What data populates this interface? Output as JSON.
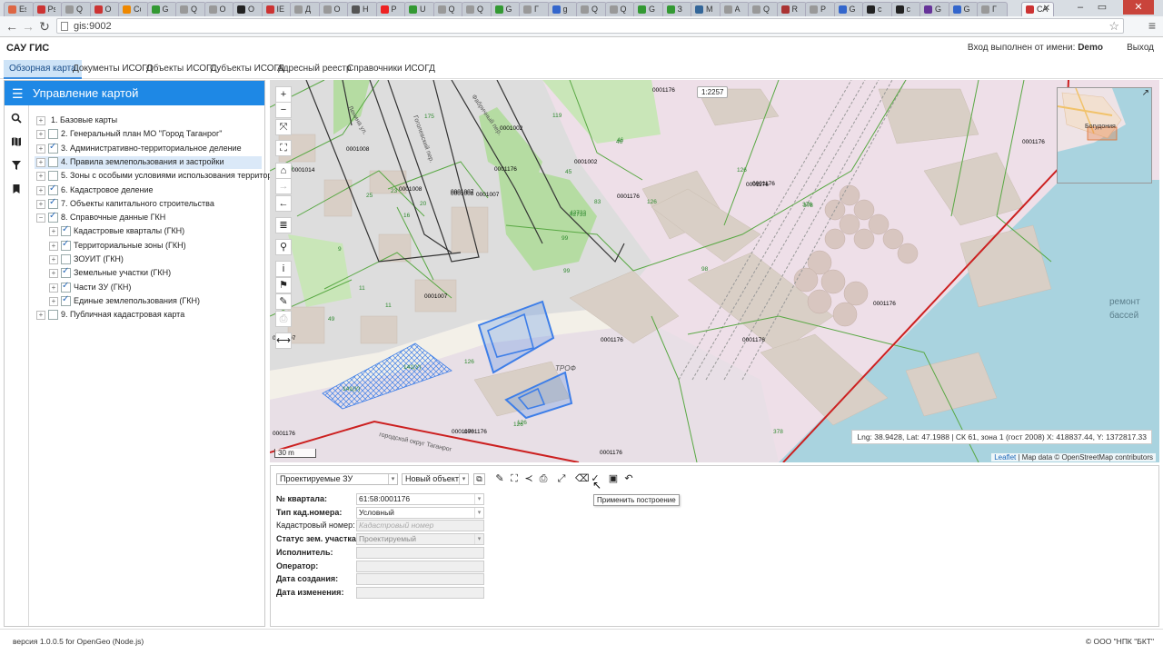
{
  "browser": {
    "url": "gis:9002",
    "active_tab_label": "СА",
    "tabs": [
      {
        "fav": "#d64",
        "label": "Es"
      },
      {
        "fav": "#c33",
        "label": "Ps"
      },
      {
        "fav": "#999",
        "label": "Q"
      },
      {
        "fav": "#c33",
        "label": "O"
      },
      {
        "fav": "#e80",
        "label": "Co"
      },
      {
        "fav": "#393",
        "label": "G"
      },
      {
        "fav": "#999",
        "label": "Q"
      },
      {
        "fav": "#999",
        "label": "O"
      },
      {
        "fav": "#222",
        "label": "O"
      },
      {
        "fav": "#c33",
        "label": "IE"
      },
      {
        "fav": "#999",
        "label": "Д"
      },
      {
        "fav": "#999",
        "label": "O"
      },
      {
        "fav": "#555",
        "label": "H"
      },
      {
        "fav": "#e22",
        "label": "P"
      },
      {
        "fav": "#393",
        "label": "U"
      },
      {
        "fav": "#999",
        "label": "Q"
      },
      {
        "fav": "#999",
        "label": "Q"
      },
      {
        "fav": "#393",
        "label": "G"
      },
      {
        "fav": "#999",
        "label": "Г"
      },
      {
        "fav": "#36c",
        "label": "g"
      },
      {
        "fav": "#999",
        "label": "Q"
      },
      {
        "fav": "#999",
        "label": "Q"
      },
      {
        "fav": "#393",
        "label": "G"
      },
      {
        "fav": "#393",
        "label": "З"
      },
      {
        "fav": "#369",
        "label": "M"
      },
      {
        "fav": "#999",
        "label": "A"
      },
      {
        "fav": "#999",
        "label": "Q"
      },
      {
        "fav": "#a33",
        "label": "R"
      },
      {
        "fav": "#999",
        "label": "P"
      },
      {
        "fav": "#36c",
        "label": "G"
      },
      {
        "fav": "#222",
        "label": "c"
      },
      {
        "fav": "#222",
        "label": "c"
      },
      {
        "fav": "#639",
        "label": "G"
      },
      {
        "fav": "#36c",
        "label": "G"
      },
      {
        "fav": "#999",
        "label": "Г"
      }
    ],
    "window_controls": [
      "–",
      "▭",
      "✕"
    ]
  },
  "header": {
    "title": "САУ ГИС",
    "login_prefix": "Вход выполнен от имени:",
    "login_user": "Demo",
    "logout": "Выход"
  },
  "nav": [
    "Обзорная карта",
    "Документы ИСОГД",
    "Объекты ИСОГД",
    "Субъекты ИСОГД",
    "Адресный реестр",
    "Справочники ИСОГД"
  ],
  "sidebar": {
    "title": "Управление картой",
    "icons": [
      "search-icon",
      "map-icon",
      "filter-icon",
      "bookmark-icon"
    ],
    "tree": [
      {
        "label": "1. Базовые карты",
        "level": 0,
        "expander": "+",
        "checkbox": false,
        "checked": false,
        "highlight": false
      },
      {
        "label": "2. Генеральный план МО \"Город Таганрог\"",
        "level": 0,
        "expander": "+",
        "checkbox": true,
        "checked": false,
        "highlight": false
      },
      {
        "label": "3. Административно-территориальное деление",
        "level": 0,
        "expander": "+",
        "checkbox": true,
        "checked": true,
        "highlight": false
      },
      {
        "label": "4. Правила землепользования и застройки",
        "level": 0,
        "expander": "+",
        "checkbox": true,
        "checked": false,
        "highlight": true
      },
      {
        "label": "5. Зоны с особыми условиями использования территории",
        "level": 0,
        "expander": "+",
        "checkbox": true,
        "checked": false,
        "highlight": false
      },
      {
        "label": "6. Кадастровое деление",
        "level": 0,
        "expander": "+",
        "checkbox": true,
        "checked": true,
        "highlight": false
      },
      {
        "label": "7. Объекты капитального строительства",
        "level": 0,
        "expander": "+",
        "checkbox": true,
        "checked": true,
        "highlight": false
      },
      {
        "label": "8. Справочные данные ГКН",
        "level": 0,
        "expander": "−",
        "checkbox": true,
        "checked": true,
        "highlight": false
      },
      {
        "label": "Кадастровые кварталы (ГКН)",
        "level": 1,
        "expander": "+",
        "checkbox": true,
        "checked": true,
        "highlight": false
      },
      {
        "label": "Территориальные зоны (ГКН)",
        "level": 1,
        "expander": "+",
        "checkbox": true,
        "checked": true,
        "highlight": false
      },
      {
        "label": "ЗОУИТ (ГКН)",
        "level": 1,
        "expander": "+",
        "checkbox": true,
        "checked": false,
        "highlight": false
      },
      {
        "label": "Земельные участки (ГКН)",
        "level": 1,
        "expander": "+",
        "checkbox": true,
        "checked": true,
        "highlight": false
      },
      {
        "label": "Части ЗУ (ГКН)",
        "level": 1,
        "expander": "+",
        "checkbox": true,
        "checked": true,
        "highlight": false
      },
      {
        "label": "Единые землепользования (ГКН)",
        "level": 1,
        "expander": "+",
        "checkbox": true,
        "checked": true,
        "highlight": false
      },
      {
        "label": "9. Публичная кадастровая карта",
        "level": 0,
        "expander": "+",
        "checkbox": true,
        "checked": false,
        "highlight": false
      }
    ]
  },
  "map": {
    "scale_badge": "1:2257",
    "coord_readout": "Lng: 38.9428, Lat: 47.1988 | СК 61, зона 1 (гост 2008) X: 418837.44, Y: 1372817.33",
    "attribution_link": "Leaflet",
    "attribution_rest": "| Map data © OpenStreetMap contributors",
    "scalebar": "30 m",
    "minimap_label": "Богудония",
    "tools": [
      {
        "name": "zoom-in-button",
        "glyph": "+"
      },
      {
        "name": "zoom-out-button",
        "glyph": "−"
      },
      {
        "name": "zoom-extent-button",
        "glyph": "⤧"
      },
      {
        "name": "fullscreen-button",
        "glyph": "⛶"
      },
      {
        "name": "home-button",
        "glyph": "⌂"
      },
      {
        "name": "forward-button",
        "glyph": "→"
      },
      {
        "name": "back-button",
        "glyph": "←"
      },
      {
        "name": "layers-list-button",
        "glyph": "≣"
      },
      {
        "name": "map-search-button",
        "glyph": "⚲"
      },
      {
        "name": "info-button",
        "glyph": "i"
      },
      {
        "name": "marker-button",
        "glyph": "⚑"
      },
      {
        "name": "edit-button",
        "glyph": "✎"
      },
      {
        "name": "print-button",
        "glyph": "⎙"
      },
      {
        "name": "measure-button",
        "glyph": "⟷"
      }
    ],
    "labels": {
      "zu_numbers": [
        "0001176",
        "0001176",
        "0001176",
        "0001176",
        "0001176",
        "0001176",
        "0001176",
        "0001176",
        "0001176",
        "0001176",
        "0001176",
        "0001176",
        "0001176",
        "0001002",
        "0001002",
        "0001008",
        "0001008",
        "0001008",
        "0001014",
        "0001007",
        "0001007",
        "0001007",
        "0001007"
      ],
      "parcel_numbers": [
        "126",
        "126",
        "126",
        "126",
        "378",
        "378",
        "378",
        "98",
        "99",
        "99",
        "83",
        "46",
        "46",
        "45",
        "42733",
        "42733",
        "119",
        "175",
        "23",
        "20",
        "16",
        "25",
        "74",
        "11",
        "11",
        "49",
        "9",
        "141(У)",
        "141(У)",
        "126"
      ],
      "streets": [
        "Фабричный пер.",
        "Ленина ул.",
        "Гоголевский пер.",
        "ТРОФ",
        "городской округ Таганрог",
        "ремонт",
        "бассей"
      ]
    }
  },
  "edit_panel": {
    "layer_select": "Проектируемые ЗУ",
    "object_select": "Новый объект",
    "tooltip": "Применить построение",
    "toolbar_icons": [
      "copy-icon",
      "pencil-icon",
      "square-select-icon",
      "share-icon",
      "print-icon",
      "resize-icon",
      "eraser-icon",
      "check-icon",
      "save-icon",
      "undo-icon"
    ],
    "fields": [
      {
        "label": "№ квартала:",
        "value": "61:58:0001176",
        "style": "select",
        "bold": true
      },
      {
        "label": "Тип кад.номера:",
        "value": "Условный",
        "style": "select",
        "bold": true
      },
      {
        "label": "Кадастровый номер:",
        "value": "Кадастровый номер",
        "style": "placeholder",
        "bold": false
      },
      {
        "label": "Статус зем. участка:",
        "value": "Проектируемый",
        "style": "readonly-select",
        "bold": true
      },
      {
        "label": "Исполнитель:",
        "value": "",
        "style": "readonly",
        "bold": true
      },
      {
        "label": "Оператор:",
        "value": "",
        "style": "readonly",
        "bold": true
      },
      {
        "label": "Дата создания:",
        "value": "",
        "style": "readonly",
        "bold": true
      },
      {
        "label": "Дата изменения:",
        "value": "",
        "style": "readonly",
        "bold": true
      }
    ]
  },
  "footer": {
    "version": "версия 1.0.0.5 for OpenGeo (Node.js)",
    "copyright": "© ООО \"НПК \"БКТ\""
  },
  "colors": {
    "accent": "#1e88e5",
    "nav_active_bg": "#cde3f7",
    "map_zone_pink": "#eedfe8",
    "water": "#a9d3df",
    "greenery": "#b5dca2",
    "building": "#d9cfc6",
    "parcel_line": "#58a843",
    "designed_parcel": "#3d7ee8",
    "boundary_red": "#cc2020"
  }
}
